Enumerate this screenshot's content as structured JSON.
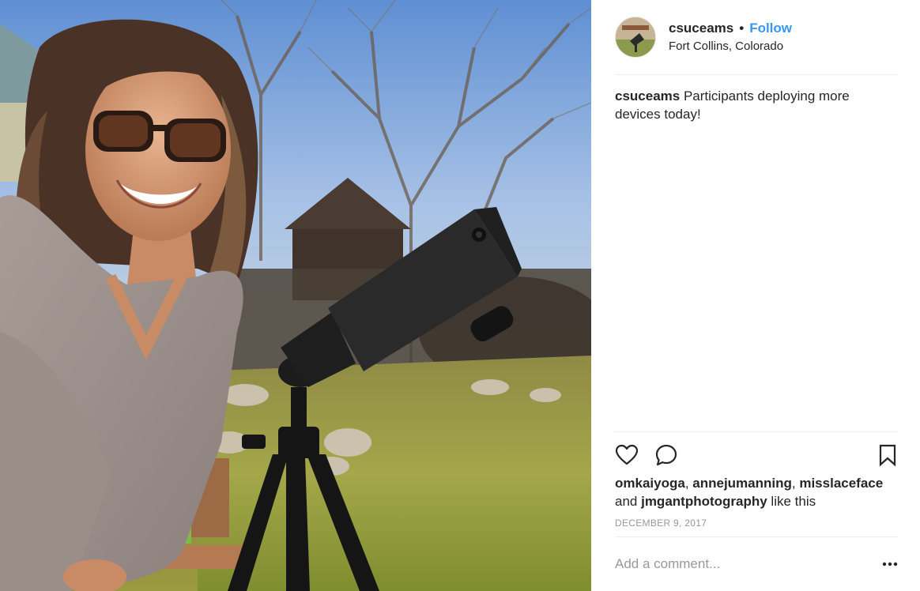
{
  "post": {
    "username": "csuceams",
    "separator": "•",
    "follow_label": "Follow",
    "location": "Fort Collins, Colorado",
    "caption_user": "csuceams",
    "caption_text": "Participants deploying more devices today!",
    "likes": {
      "users": [
        "omkaiyoga",
        "annejumanning",
        "misslaceface",
        "jmgantphotography"
      ],
      "comma1": ", ",
      "comma2": ", ",
      "and_text": "and ",
      "suffix": " like this"
    },
    "date": "DECEMBER 9, 2017",
    "comment_placeholder": "Add a comment..."
  },
  "icons": {
    "like": "heart-icon",
    "comment": "speech-bubble-icon",
    "save": "bookmark-icon",
    "more": "ellipsis-icon"
  },
  "colors": {
    "accent": "#3897f0",
    "text": "#262626",
    "muted": "#999999",
    "divider": "#efefef"
  }
}
